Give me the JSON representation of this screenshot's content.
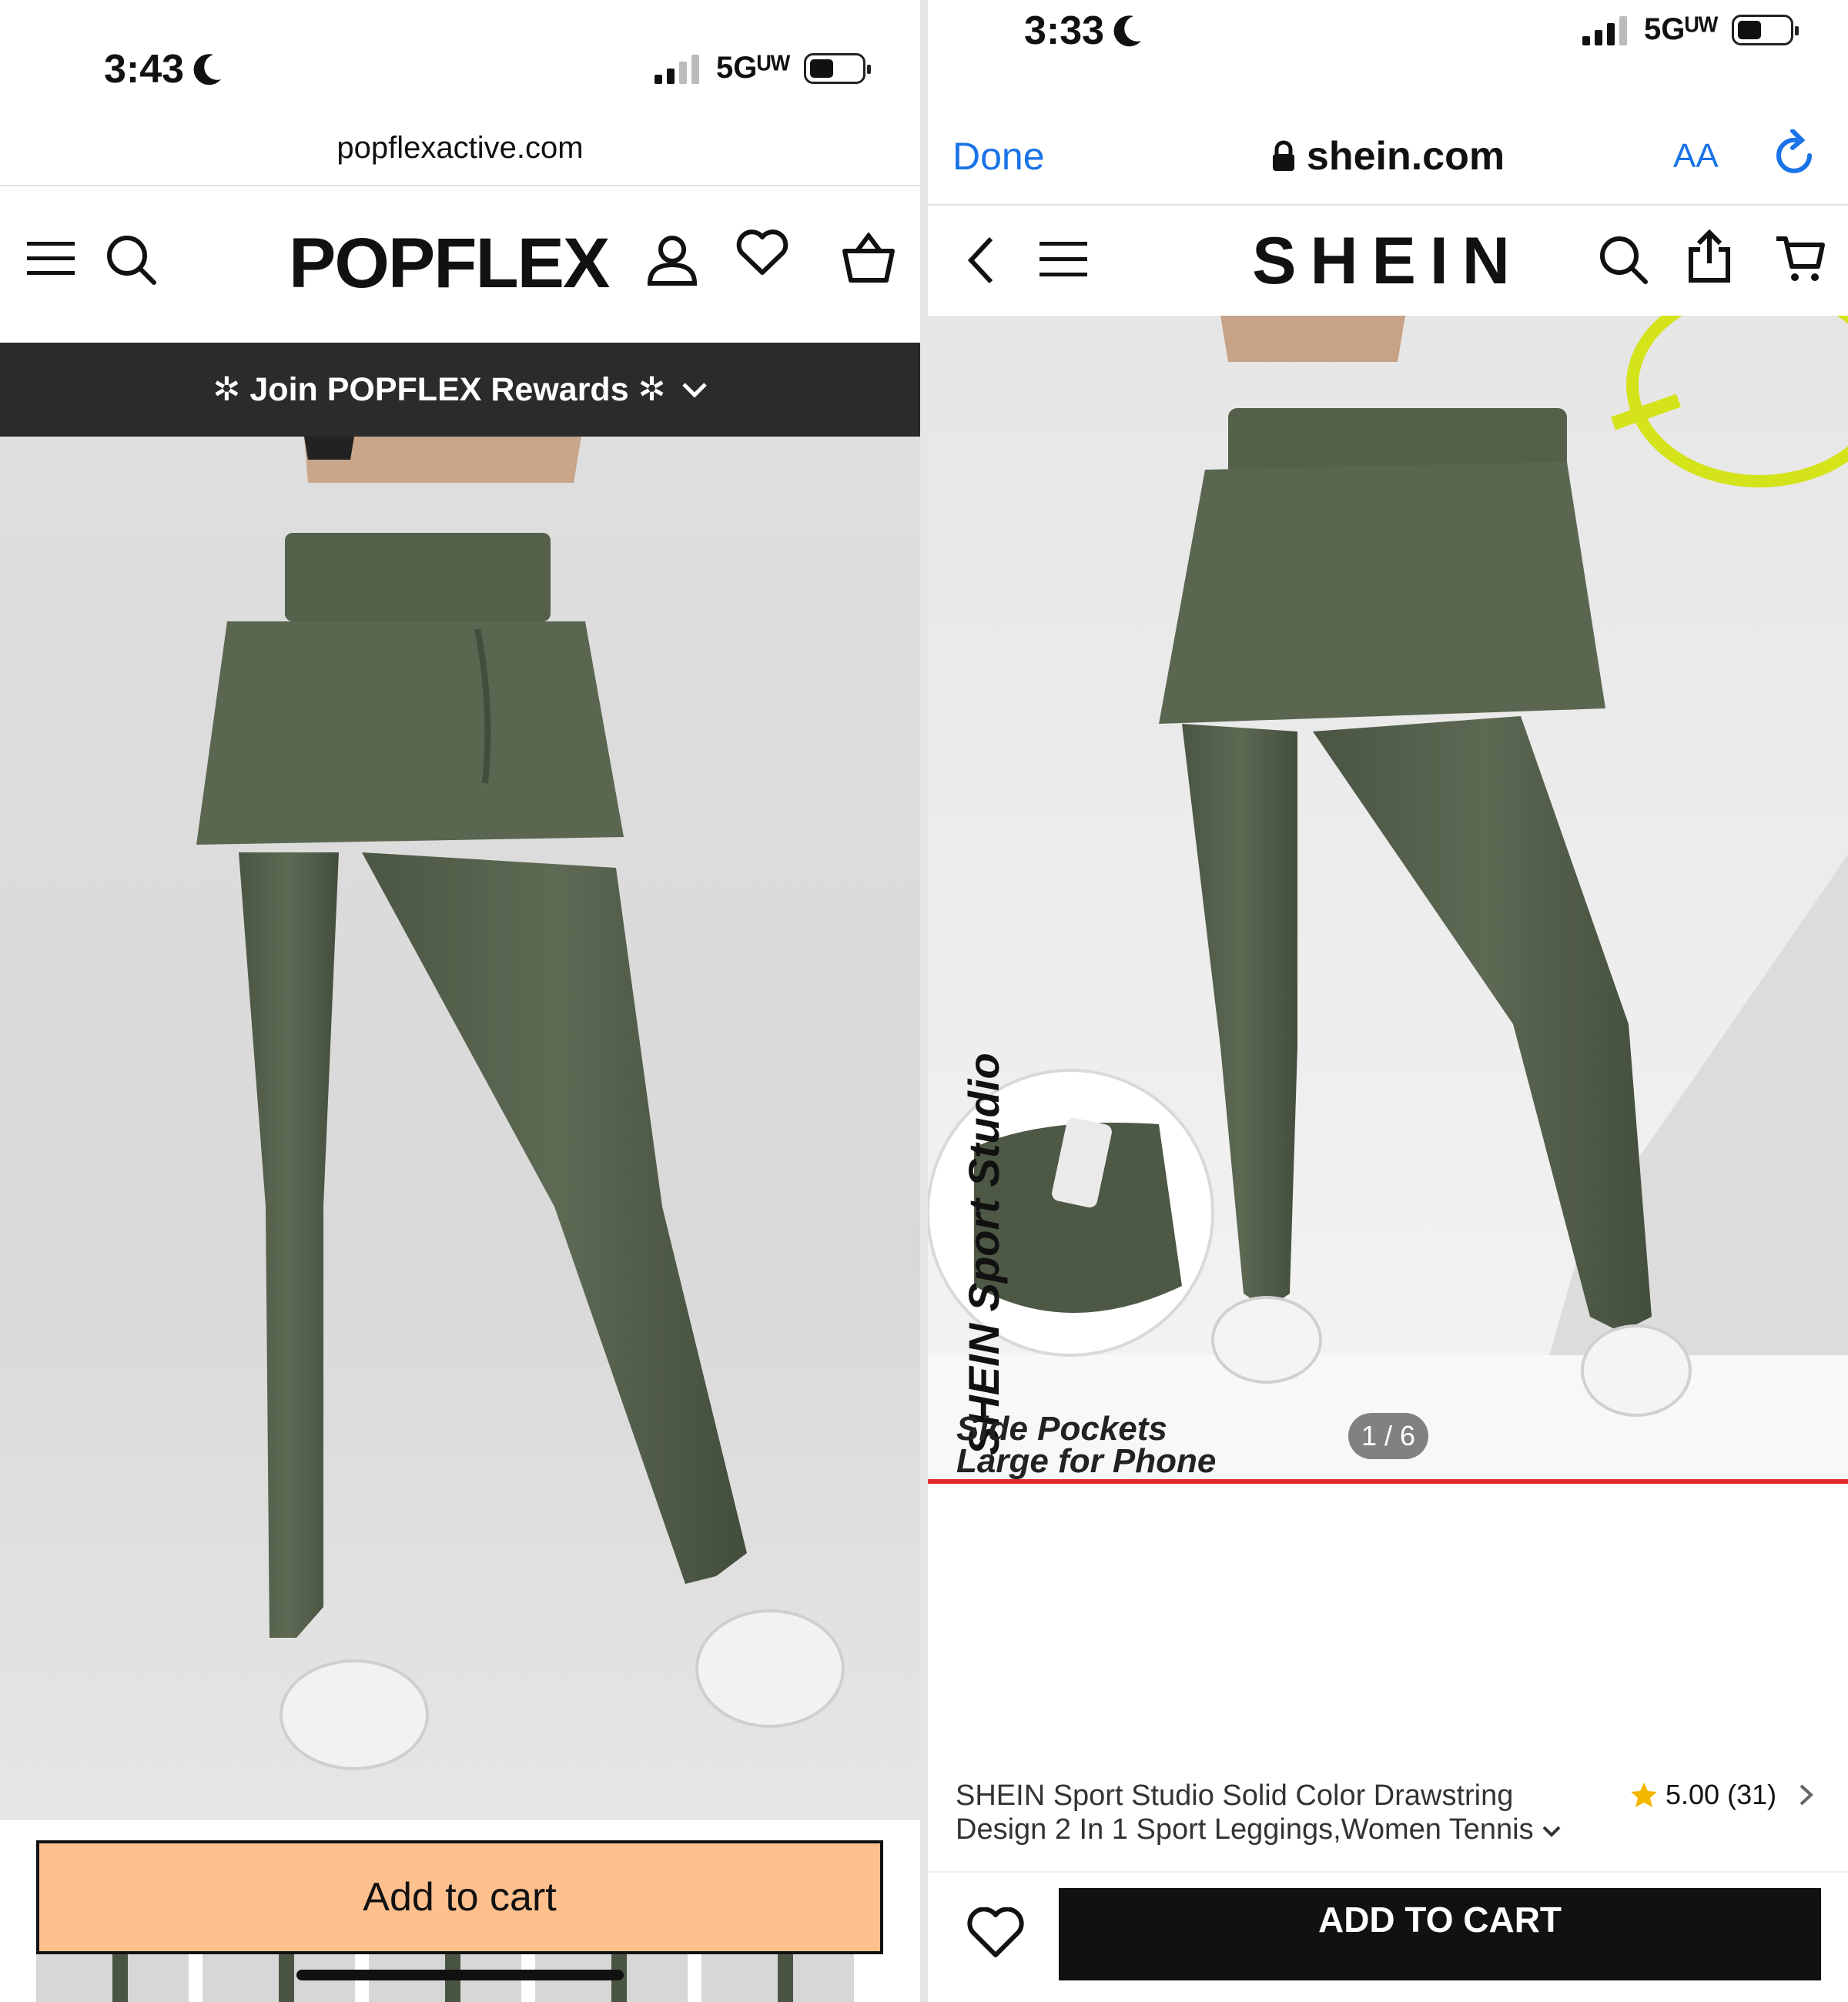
{
  "left": {
    "status": {
      "time": "3:43",
      "network": "5Gᵁᵂ"
    },
    "url": "popflexactive.com",
    "brand": "POPFLEX",
    "banner": {
      "text": "✲ Join POPFLEX Rewards ✲"
    },
    "add_to_cart": "Add to cart"
  },
  "right": {
    "status": {
      "time": "3:33",
      "network": "5Gᵁᵂ"
    },
    "safari": {
      "done": "Done",
      "url": "shein.com",
      "text_size": "AA"
    },
    "brand": "SHEIN",
    "image_overlay": {
      "brand_line": "SHEIN Sport Studio",
      "pocket_line1": "Side Pockets",
      "pocket_line2": "Large for Phone"
    },
    "pager": "1 / 6",
    "product_title": "SHEIN Sport Studio Solid Color Drawstring Design 2 In 1 Sport Leggings,Women Tennis",
    "rating": {
      "value": "5.00",
      "count": "(31)"
    },
    "add_to_cart": "ADD TO CART"
  },
  "colors": {
    "popflex_cta": "#ffc08e",
    "shein_cta": "#111111",
    "olive": "#4f5a46",
    "safari_blue": "#1a73e8",
    "progress_red": "#e02a2a",
    "star": "#f5b800"
  }
}
